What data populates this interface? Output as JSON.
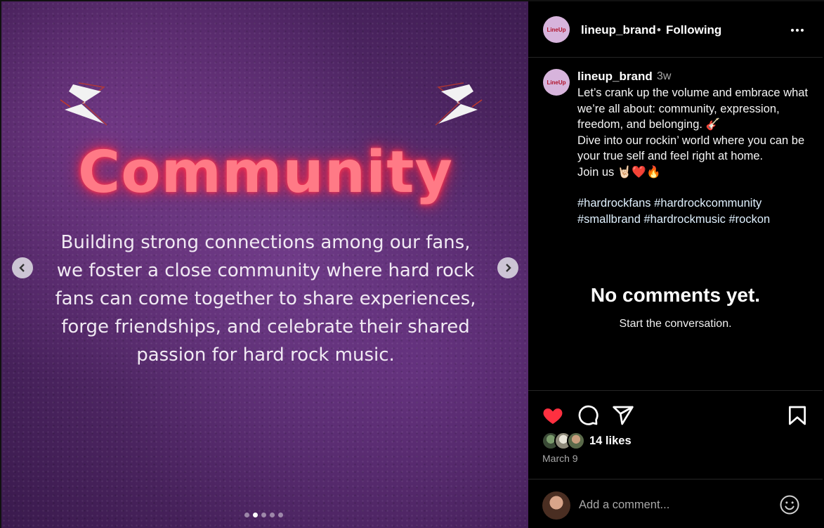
{
  "media": {
    "title": "Community",
    "body": "Building strong connections among our fans, we foster a close community where hard rock fans can come together to share experiences, forge friendships, and celebrate their shared passion for hard rock music.",
    "carousel": {
      "total_slides": 5,
      "active_index": 1
    },
    "accent_color": "#ff7a86",
    "background_color": "#5a2c70"
  },
  "header": {
    "username": "lineup_brand",
    "separator": "•",
    "follow_status": "Following",
    "more_icon": "more-horizontal-icon"
  },
  "caption": {
    "username": "lineup_brand",
    "time": "3w",
    "lines": [
      "Let’s crank up the volume and embrace what we’re all about: community, expression, freedom, and belonging. 🎸",
      "Dive into our rockin’ world where you can be your true self and feel right at home.",
      "Join us 🤘🏻❤️🔥"
    ],
    "hashtags": "#hardrockfans #hardrockcommunity #smallbrand #hardrockmusic #rockon"
  },
  "comments": {
    "empty_title": "No comments yet.",
    "empty_subtitle": "Start the conversation."
  },
  "actions": {
    "liked": true,
    "like_color": "#ff3040",
    "likes_text": "14 likes",
    "date": "March 9"
  },
  "comment_box": {
    "placeholder": "Add a comment..."
  }
}
